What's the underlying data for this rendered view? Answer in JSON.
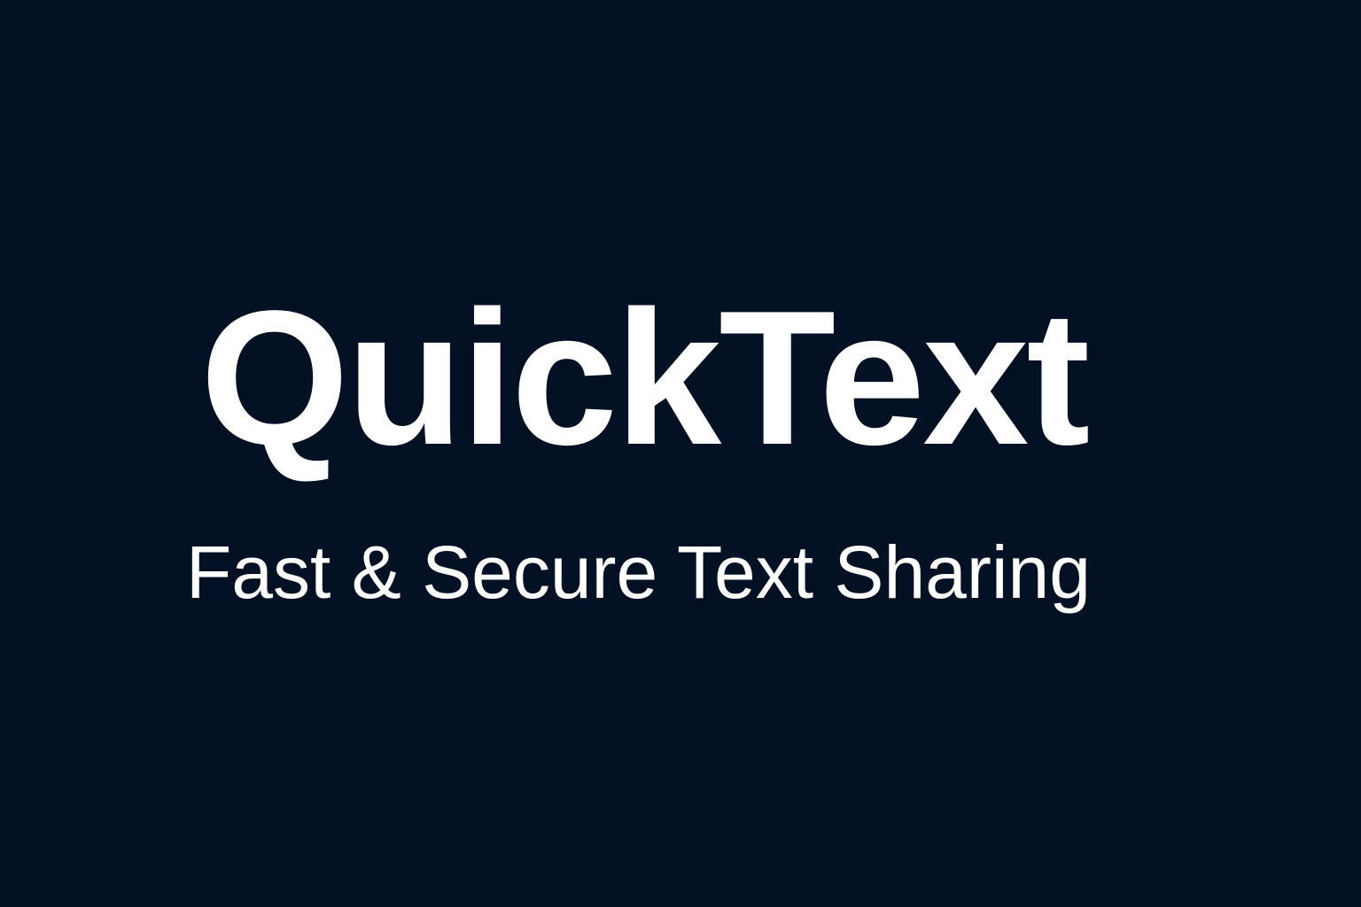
{
  "hero": {
    "title": "QuickText",
    "subtitle": "Fast & Secure Text Sharing"
  },
  "colors": {
    "background": "#041124",
    "text": "#ffffff"
  }
}
